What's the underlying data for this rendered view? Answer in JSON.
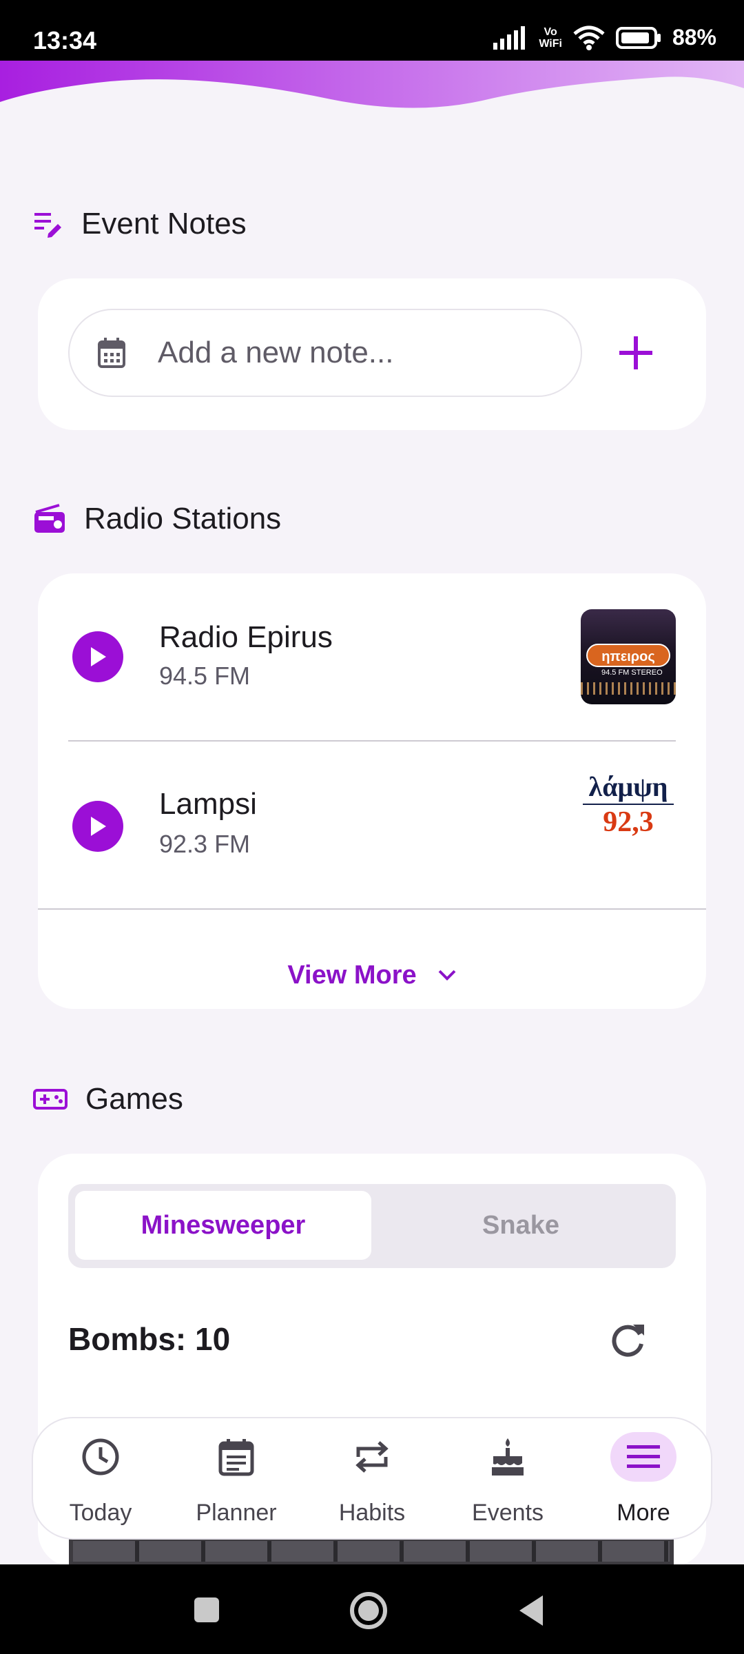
{
  "status_bar": {
    "time": "13:34",
    "vo": "Vo",
    "wifi_label": "WiFi",
    "battery": "88%"
  },
  "event_notes": {
    "title": "Event Notes",
    "input_placeholder": "Add a new note..."
  },
  "radio": {
    "title": "Radio Stations",
    "stations": [
      {
        "name": "Radio Epirus",
        "frequency": "94.5 FM",
        "logo_text": "ηπειρος",
        "logo_sub": "94.5 FM STEREO"
      },
      {
        "name": "Lampsi",
        "frequency": "92.3 FM",
        "logo_word": "λάμψη",
        "logo_num": "92,3"
      }
    ],
    "view_more": "View More"
  },
  "games": {
    "title": "Games",
    "tabs": [
      "Minesweeper",
      "Snake"
    ],
    "active_tab": "Minesweeper",
    "bombs_label": "Bombs: 10"
  },
  "bottom_nav": {
    "items": [
      {
        "label": "Today",
        "icon": "clock-icon"
      },
      {
        "label": "Planner",
        "icon": "planner-icon"
      },
      {
        "label": "Habits",
        "icon": "repeat-icon"
      },
      {
        "label": "Events",
        "icon": "cake-icon"
      },
      {
        "label": "More",
        "icon": "menu-icon"
      }
    ],
    "active": "More"
  },
  "colors": {
    "accent": "#9b0fd6",
    "background": "#f6f3f9",
    "card": "#ffffff"
  }
}
